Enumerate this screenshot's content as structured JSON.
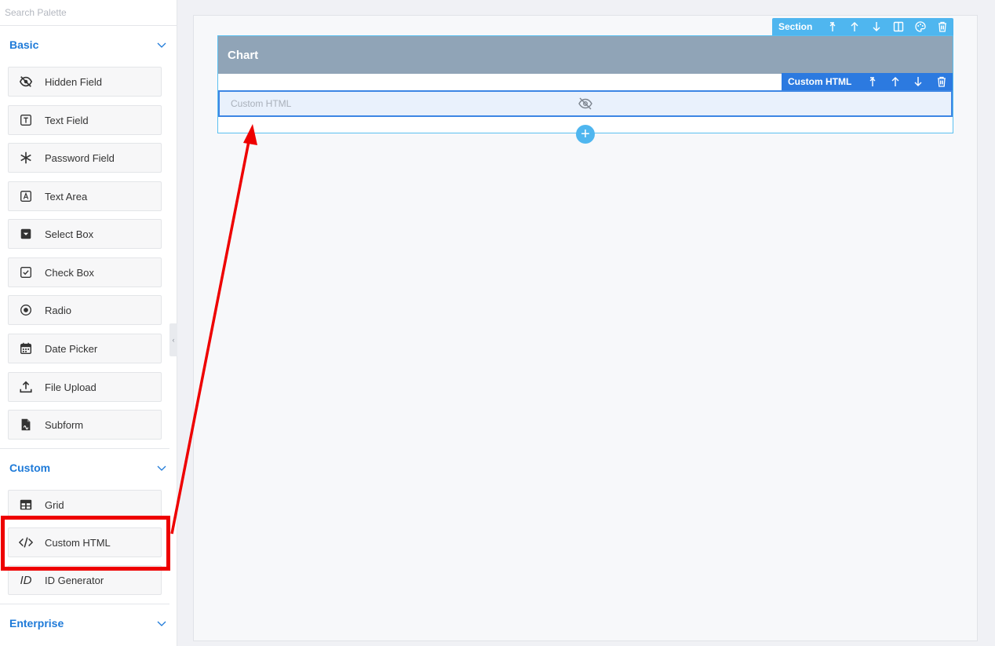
{
  "search": {
    "placeholder": "Search Palette"
  },
  "groups": {
    "basic": {
      "title": "Basic"
    },
    "custom": {
      "title": "Custom"
    },
    "enterprise": {
      "title": "Enterprise"
    }
  },
  "basic_items": [
    {
      "label": "Hidden Field",
      "icon": "eye-off-icon"
    },
    {
      "label": "Text Field",
      "icon": "text-field-icon"
    },
    {
      "label": "Password Field",
      "icon": "asterisk-icon"
    },
    {
      "label": "Text Area",
      "icon": "text-area-icon"
    },
    {
      "label": "Select Box",
      "icon": "select-box-icon"
    },
    {
      "label": "Check Box",
      "icon": "checkbox-icon"
    },
    {
      "label": "Radio",
      "icon": "radio-icon"
    },
    {
      "label": "Date Picker",
      "icon": "calendar-icon"
    },
    {
      "label": "File Upload",
      "icon": "upload-icon"
    },
    {
      "label": "Subform",
      "icon": "document-icon"
    }
  ],
  "custom_items": [
    {
      "label": "Grid",
      "icon": "grid-icon"
    },
    {
      "label": "Custom HTML",
      "icon": "code-icon"
    },
    {
      "label": "ID Generator",
      "icon": "id-icon",
      "icon_text": "ID"
    }
  ],
  "canvas": {
    "section_toolbar_label": "Section",
    "section_title": "Chart",
    "component_toolbar_label": "Custom HTML",
    "component_label": "Custom HTML",
    "add_symbol": "+"
  },
  "colors": {
    "accent": "#1e7ad8",
    "section_header": "#90a4b7",
    "section_toolbar": "#4fb6ef",
    "component_toolbar": "#2c7ae0",
    "annotation": "#ee0000"
  }
}
